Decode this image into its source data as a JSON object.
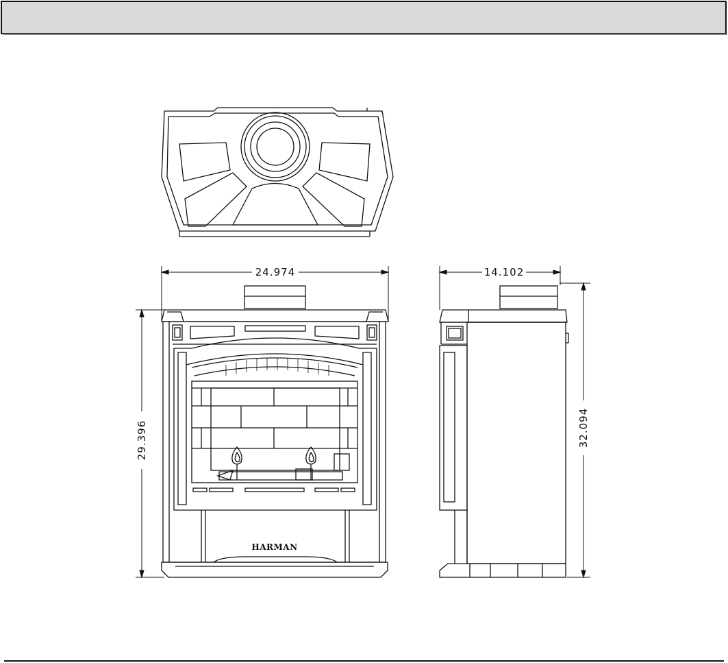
{
  "header": {
    "title": ""
  },
  "dimensions": {
    "front_width": "24.974",
    "front_height": "29.396",
    "side_depth": "14.102",
    "side_height": "32.094"
  },
  "brand": {
    "logo_text": "HARMAN"
  },
  "colors": {
    "line": "#111111",
    "header_fill": "#d9d9d9",
    "background": "#ffffff"
  }
}
